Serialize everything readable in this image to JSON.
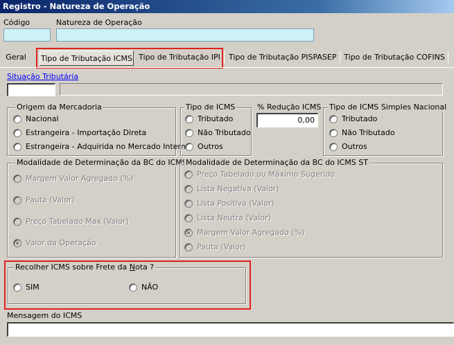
{
  "window": {
    "title": "Registro - Natureza de Operação"
  },
  "fields": {
    "codigo_label": "Código",
    "codigo_value": "",
    "natureza_label": "Natureza de Operação",
    "natureza_value": ""
  },
  "tabs": [
    {
      "label": "Geral"
    },
    {
      "label": "Tipo de Tributação  ICMS"
    },
    {
      "label": "Tipo de Tributação IPI"
    },
    {
      "label": "Tipo de Tributação PISPASEP"
    },
    {
      "label": "Tipo de Tributação COFINS"
    }
  ],
  "situacao": {
    "label": "Situação Tributária",
    "code": "",
    "description": ""
  },
  "origem": {
    "title": "Origem da Mercadoria",
    "options": [
      "Nacional",
      "Estrangeira - Importação Direta",
      "Estrangeira - Adquirida no Mercado Interno"
    ]
  },
  "tipo_icms": {
    "title": "Tipo de ICMS",
    "options": [
      "Tributado",
      "Não Tributado",
      "Outros"
    ]
  },
  "reducao": {
    "label": "% Redução ICMS",
    "value": "0,00"
  },
  "simples": {
    "title": "Tipo de ICMS Simples Nacional",
    "options": [
      "Tributado",
      "Não Tributado",
      "Outros"
    ]
  },
  "modalidade_bc": {
    "title": "Modalidade de Determinação da BC do ICMS",
    "options": [
      "Margem Valor Agregado (%)",
      "Pauta (Valor)",
      "Preço Tabelado Max (Valor)",
      "Valor da Operação"
    ],
    "selected": "Valor da Operação"
  },
  "modalidade_st": {
    "title": "Modalidade de Determinação da BC do ICMS ST",
    "options": [
      "Preço Tabelado ou  Máximo Sugerido",
      "Lista Negativa (Valor)",
      "Lista Positiva (Valor)",
      "Lista Neutra (Valor)",
      "Margem Valor Agregado (%)",
      "Pauta (Valor)"
    ],
    "selected": "Margem Valor Agregado (%)"
  },
  "frete": {
    "title_prefix": "Recolher ICMS sobre Frete da ",
    "title_underlined": "N",
    "title_suffix": "ota ?",
    "option_sim": "SIM",
    "option_nao": "NÃO"
  },
  "mensagem": {
    "label": "Mensagem do ICMS",
    "value": ""
  },
  "colors": {
    "highlight": "#e0201c",
    "input_bg": "#cdf2f5",
    "title_bg": "#0a246a"
  }
}
